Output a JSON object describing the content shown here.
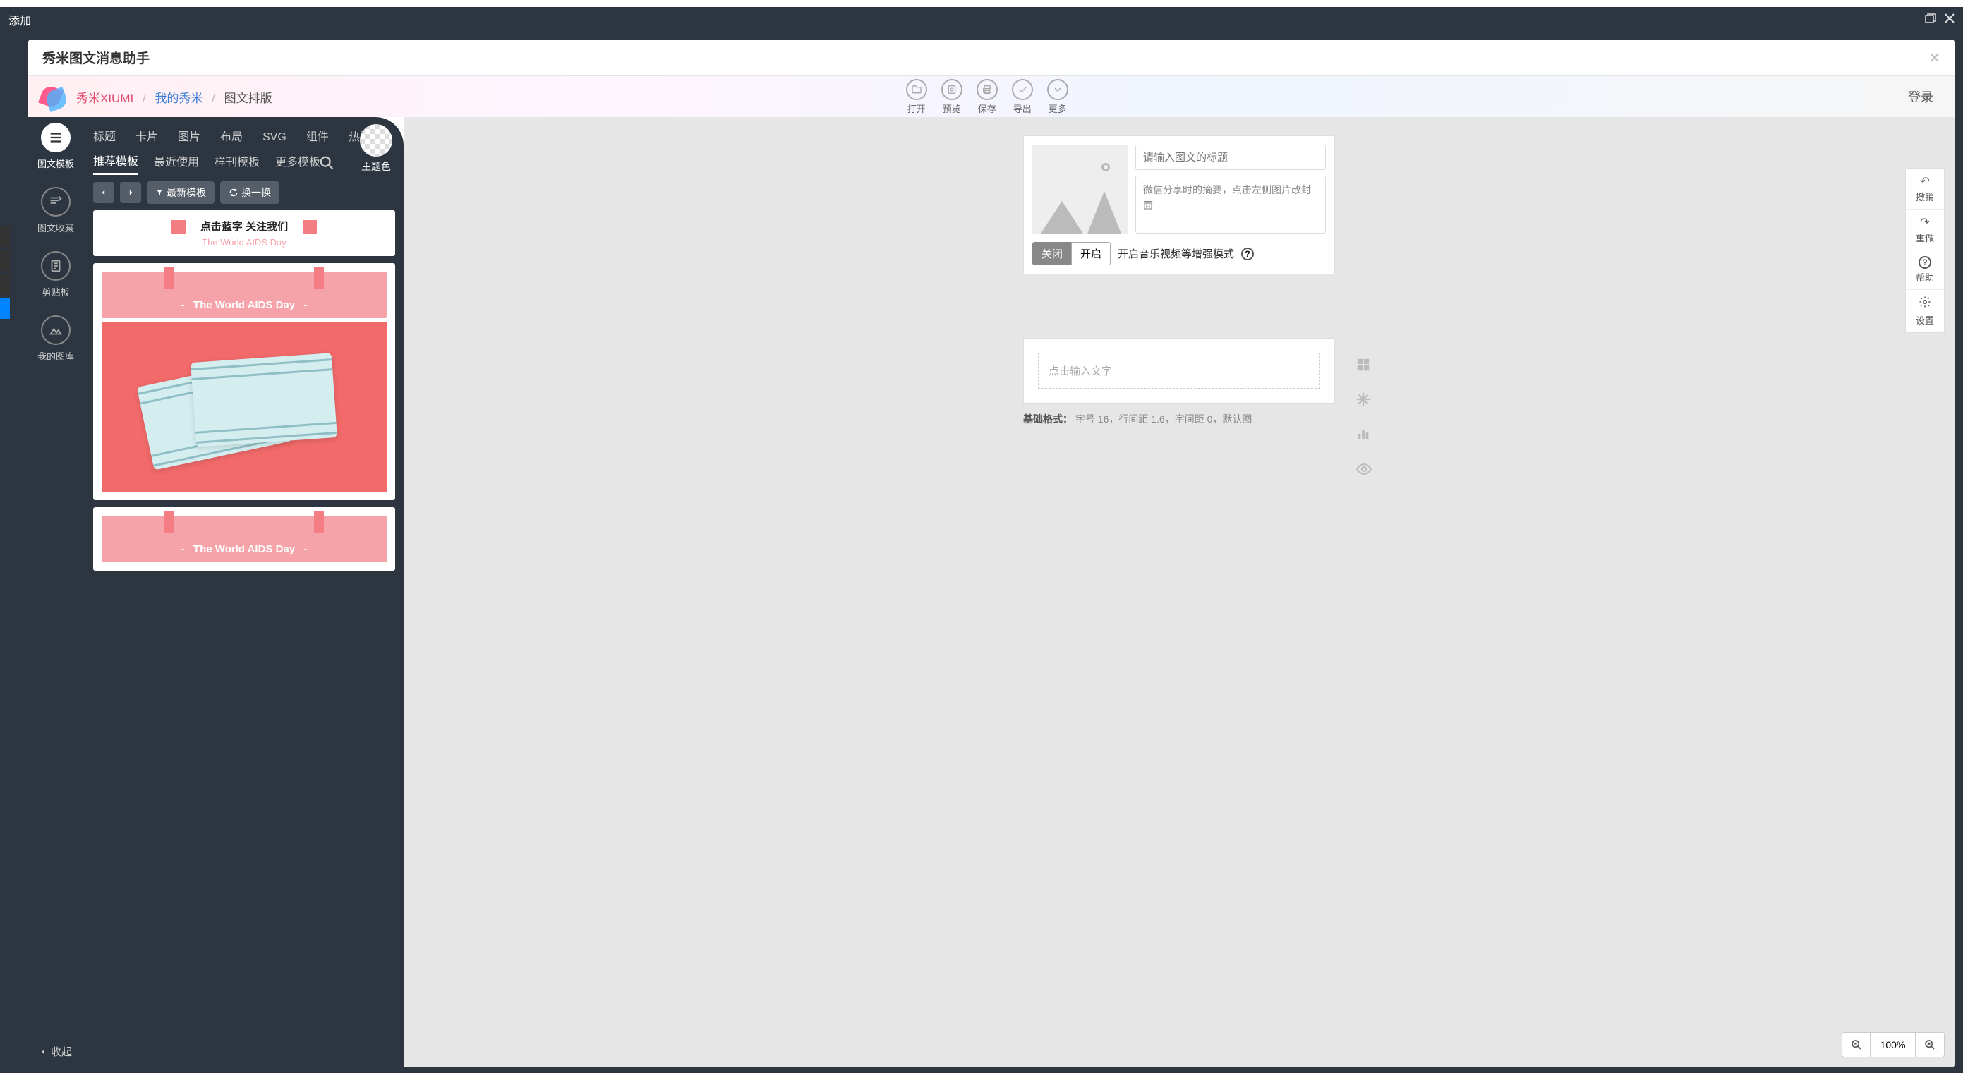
{
  "titlebar": {
    "label": "添加"
  },
  "modal": {
    "title": "秀米图文消息助手"
  },
  "breadcrumb": {
    "brand": "秀米XIUMI",
    "link": "我的秀米",
    "current": "图文排版"
  },
  "top_actions": {
    "open": "打开",
    "preview": "预览",
    "save": "保存",
    "export": "导出",
    "more": "更多"
  },
  "login": "登录",
  "left_nav": {
    "template": "图文模板",
    "favorites": "图文收藏",
    "clipboard": "剪贴板",
    "gallery": "我的图库",
    "collapse": "收起"
  },
  "tabs": {
    "title": "标题",
    "card": "卡片",
    "image": "图片",
    "layout": "布局",
    "svg": "SVG",
    "component": "组件",
    "hot": "热门"
  },
  "subtabs": {
    "recommend": "推荐模板",
    "recent": "最近使用",
    "sample": "样刊模板",
    "more": "更多模板"
  },
  "theme_color": "主题色",
  "toolbar": {
    "latest": "最新模板",
    "shuffle": "换一换"
  },
  "templates": [
    {
      "title": "点击蓝字 关注我们",
      "subtitle": "The World AIDS Day"
    },
    {
      "title": "The World AIDS Day"
    },
    {
      "title": "The World AIDS Day"
    }
  ],
  "editor": {
    "title_placeholder": "请输入图文的标题",
    "summary_text": "微信分享时的摘要，点击左侧图片改封面",
    "close": "关闭",
    "open": "开启",
    "mode_label": "开启音乐视频等增强模式",
    "text_placeholder": "点击输入文字",
    "format_label": "基础格式：",
    "format_value": "字号 16，行间距 1.6，字间距 0，默认图"
  },
  "right_actions": {
    "undo": "撤销",
    "redo": "重做",
    "help": "帮助",
    "settings": "设置"
  },
  "zoom": {
    "level": "100%"
  }
}
